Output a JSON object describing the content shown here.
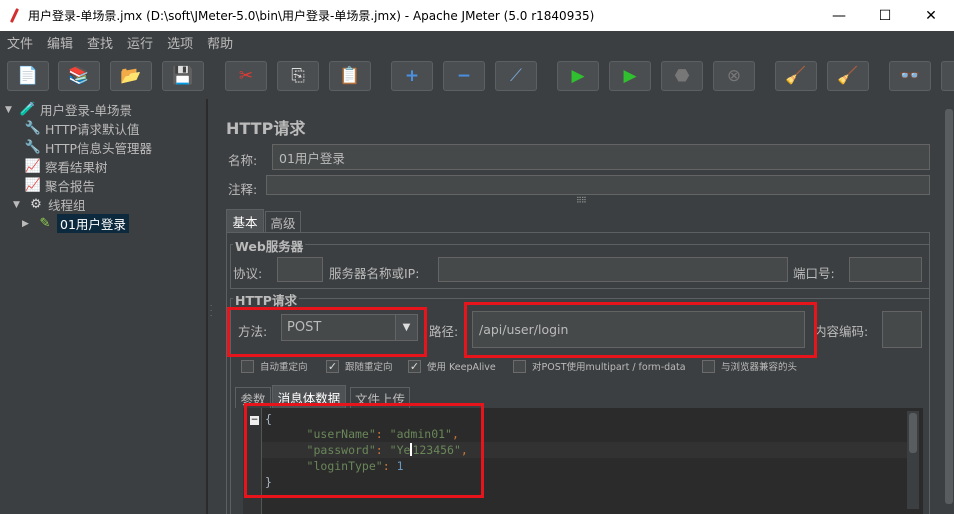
{
  "window": {
    "title": "用户登录-单场景.jmx (D:\\soft\\JMeter-5.0\\bin\\用户登录-单场景.jmx) - Apache JMeter (5.0 r1840935)",
    "minimize": "—",
    "maximize": "☐",
    "close": "✕"
  },
  "menu": [
    "文件",
    "编辑",
    "查找",
    "运行",
    "选项",
    "帮助"
  ],
  "toolbar": [
    {
      "name": "new-icon",
      "glyph": "📄"
    },
    {
      "name": "templates-icon",
      "glyph": "📚"
    },
    {
      "name": "open-icon",
      "glyph": "📂"
    },
    {
      "name": "save-icon",
      "glyph": "💾"
    },
    {
      "name": "cut-icon",
      "glyph": "✂"
    },
    {
      "name": "copy-icon",
      "glyph": "⎘"
    },
    {
      "name": "paste-icon",
      "glyph": "📋"
    },
    {
      "name": "expand-icon",
      "glyph": "+"
    },
    {
      "name": "collapse-icon",
      "glyph": "−"
    },
    {
      "name": "toggle-icon",
      "glyph": "⟋"
    },
    {
      "name": "start-icon",
      "glyph": "▶"
    },
    {
      "name": "start-no-pause-icon",
      "glyph": "▶"
    },
    {
      "name": "stop-icon",
      "glyph": "⬣"
    },
    {
      "name": "shutdown-icon",
      "glyph": "⊗"
    },
    {
      "name": "clear-icon",
      "glyph": "🧹"
    },
    {
      "name": "clear-all-icon",
      "glyph": "🧹"
    },
    {
      "name": "search-icon",
      "glyph": "👓"
    },
    {
      "name": "reset-search-icon",
      "glyph": "🧹"
    }
  ],
  "tree": [
    {
      "label": "用户登录-单场景",
      "icon": "🧪",
      "arrow": "▼"
    },
    {
      "label": "HTTP请求默认值",
      "icon": "🔧",
      "arrow": ""
    },
    {
      "label": "HTTP信息头管理器",
      "icon": "🔧",
      "arrow": ""
    },
    {
      "label": "察看结果树",
      "icon": "📈",
      "arrow": ""
    },
    {
      "label": "聚合报告",
      "icon": "📈",
      "arrow": ""
    },
    {
      "label": "线程组",
      "icon": "⚙",
      "arrow": "▼"
    },
    {
      "label": "01用户登录",
      "icon": "✎",
      "arrow": "▶"
    }
  ],
  "panel": {
    "title": "HTTP请求",
    "name_label": "名称:",
    "name_value": "01用户登录",
    "comment_label": "注释:",
    "comment_value": "",
    "tabs": [
      "基本",
      "高级"
    ],
    "web_server": {
      "group_title": "Web服务器",
      "protocol_label": "协议:",
      "protocol_value": "",
      "server_label": "服务器名称或IP:",
      "server_value": "",
      "port_label": "端口号:",
      "port_value": ""
    },
    "http_request": {
      "group_title": "HTTP请求",
      "method_label": "方法:",
      "method_value": "POST",
      "path_label": "路径:",
      "path_value": "/api/user/login",
      "encoding_label": "内容编码:",
      "encoding_value": ""
    },
    "checkboxes": [
      {
        "label": "自动重定向",
        "checked": false
      },
      {
        "label": "跟随重定向",
        "checked": true
      },
      {
        "label": "使用 KeepAlive",
        "checked": true
      },
      {
        "label": "对POST使用multipart / form-data",
        "checked": false
      },
      {
        "label": "与浏览器兼容的头",
        "checked": false
      }
    ],
    "body_tabs": [
      "参数",
      "消息体数据",
      "文件上传"
    ],
    "body": {
      "open_brace": "{",
      "key1": "\"userName\"",
      "val1": "\"admin01\"",
      "key2": "\"password\"",
      "val2_a": "\"Ye",
      "val2_b": "123456\"",
      "key3": "\"loginType\"",
      "val3": "1",
      "close_brace": "}",
      "fold_glyph": "−"
    }
  }
}
